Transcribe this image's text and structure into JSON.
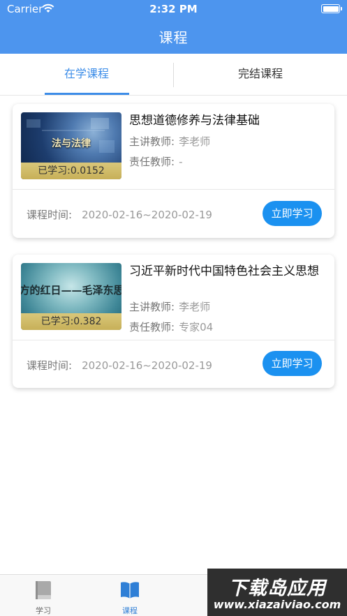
{
  "status_bar": {
    "carrier": "Carrier",
    "time": "2:32 PM",
    "wifi_icon": "wifi-icon",
    "battery_icon": "battery-icon"
  },
  "header": {
    "title": "课程",
    "color": "#4d95ee"
  },
  "tabs": [
    {
      "label": "在学课程",
      "active": true
    },
    {
      "label": "完结课程",
      "active": false
    }
  ],
  "courses": [
    {
      "title": "思想道德修养与法律基础",
      "thumb_text": "法与法律",
      "progress": "已学习:0.0152",
      "teacher_label": "主讲教师:",
      "teacher": "李老师",
      "owner_label": "责任教师:",
      "owner": "-",
      "time_label": "课程时间:",
      "time": "2020-02-16~2020-02-19",
      "button": "立即学习"
    },
    {
      "title": "习近平新时代中国特色社会主义思想",
      "thumb_text": "方的红日——毛泽东思想",
      "progress": "已学习:0.382",
      "teacher_label": "主讲教师:",
      "teacher": "李老师",
      "owner_label": "责任教师:",
      "owner": "专家04",
      "time_label": "课程时间:",
      "time": "2020-02-16~2020-02-19",
      "button": "立即学习"
    }
  ],
  "bottom_nav": [
    {
      "label": "学习",
      "icon": "book-closed-icon",
      "active": false
    },
    {
      "label": "课程",
      "icon": "book-open-icon",
      "active": true
    },
    {
      "label": "",
      "icon": "partial-icon",
      "active": false
    }
  ],
  "watermark": {
    "text": "下载岛应用",
    "url": "www.xiazaiviao.com"
  },
  "colors": {
    "accent": "#3d8de8",
    "button": "#1b91f0",
    "progress_bg": "#d4c06e"
  }
}
